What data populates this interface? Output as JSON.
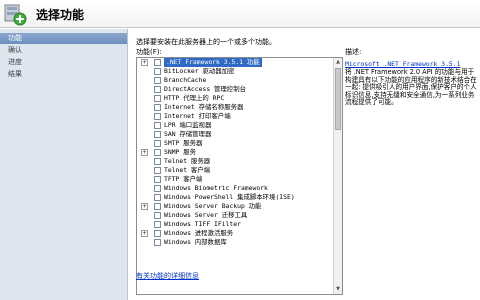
{
  "header": {
    "title": "选择功能"
  },
  "sidebar": {
    "items": [
      {
        "label": "功能",
        "active": true
      },
      {
        "label": "确认",
        "active": false
      },
      {
        "label": "进度",
        "active": false
      },
      {
        "label": "结果",
        "active": false
      }
    ]
  },
  "main": {
    "instruction": "选择要安装在此服务器上的一个或多个功能。",
    "features_label": "功能(F):",
    "features": [
      {
        "label": ".NET Framework 3.5.1 功能",
        "expandable": true,
        "selected": true
      },
      {
        "label": "BitLocker 驱动器加密",
        "expandable": false,
        "selected": false
      },
      {
        "label": "BranchCache",
        "expandable": false,
        "selected": false
      },
      {
        "label": "DirectAccess 管理控制台",
        "expandable": false,
        "selected": false
      },
      {
        "label": "HTTP 代理上的 RPC",
        "expandable": false,
        "selected": false
      },
      {
        "label": "Internet 存储名称服务器",
        "expandable": false,
        "selected": false
      },
      {
        "label": "Internet 打印客户端",
        "expandable": false,
        "selected": false
      },
      {
        "label": "LPR 端口监视器",
        "expandable": false,
        "selected": false
      },
      {
        "label": "SAN 存储管理器",
        "expandable": false,
        "selected": false
      },
      {
        "label": "SMTP 服务器",
        "expandable": false,
        "selected": false
      },
      {
        "label": "SNMP 服务",
        "expandable": true,
        "selected": false
      },
      {
        "label": "Telnet 服务器",
        "expandable": false,
        "selected": false
      },
      {
        "label": "Telnet 客户端",
        "expandable": false,
        "selected": false
      },
      {
        "label": "TFTP 客户端",
        "expandable": false,
        "selected": false
      },
      {
        "label": "Windows Biometric Framework",
        "expandable": false,
        "selected": false
      },
      {
        "label": "Windows PowerShell 集成脚本环境(ISE)",
        "expandable": false,
        "selected": false
      },
      {
        "label": "Windows Server Backup 功能",
        "expandable": true,
        "selected": false
      },
      {
        "label": "Windows Server 迁移工具",
        "expandable": false,
        "selected": false
      },
      {
        "label": "Windows TIFF IFilter",
        "expandable": false,
        "selected": false
      },
      {
        "label": "Windows 进程激活服务",
        "expandable": true,
        "selected": false
      },
      {
        "label": "Windows 内部数据库",
        "expandable": false,
        "selected": false
      }
    ],
    "more_info_link": "有关功能的详细信息",
    "description_label": "描述:",
    "description_link": "Microsoft .NET Framework 3.5.1",
    "description_text": "将 .NET Framework 2.0 API 的功能与用于构建具有以下功能的应用程序的新技术结合在一起: 提供吸引人的用户界面,保护客户的个人标识信息,支持无缝和安全通信,为一系列业务流程提供了可能。"
  },
  "colors": {
    "sidebar_bg": "#dde5ee",
    "sidebar_active": "#7597c5",
    "selection": "#3169c6",
    "link": "#0033cc"
  }
}
